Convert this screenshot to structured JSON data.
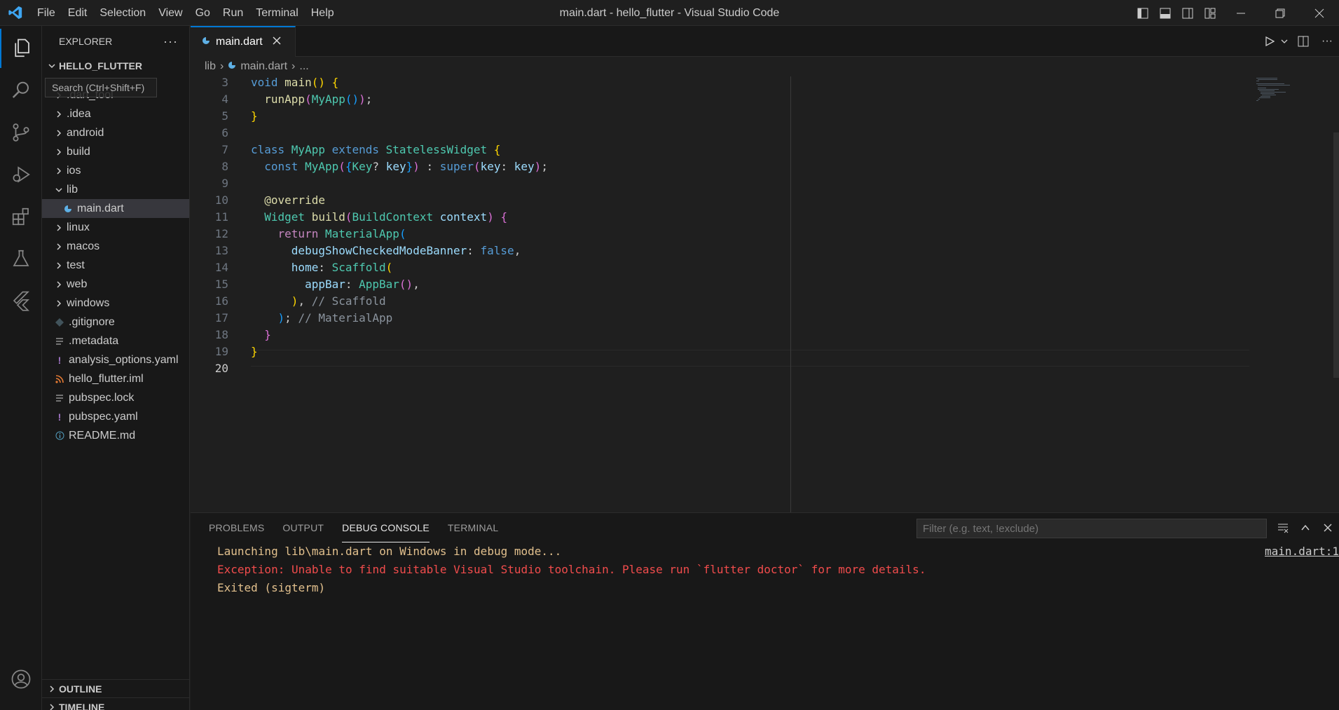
{
  "window": {
    "title": "main.dart - hello_flutter - Visual Studio Code"
  },
  "menu": [
    "File",
    "Edit",
    "Selection",
    "View",
    "Go",
    "Run",
    "Terminal",
    "Help"
  ],
  "tooltip": "Search (Ctrl+Shift+F)",
  "sidebar": {
    "title": "EXPLORER",
    "project": "HELLO_FLUTTER",
    "items": [
      {
        "label": ".dart_tool",
        "kind": "folder",
        "expanded": false
      },
      {
        "label": ".idea",
        "kind": "folder",
        "expanded": false
      },
      {
        "label": "android",
        "kind": "folder",
        "expanded": false
      },
      {
        "label": "build",
        "kind": "folder",
        "expanded": false
      },
      {
        "label": "ios",
        "kind": "folder",
        "expanded": false
      },
      {
        "label": "lib",
        "kind": "folder",
        "expanded": true
      },
      {
        "label": "main.dart",
        "kind": "dart",
        "selected": true
      },
      {
        "label": "linux",
        "kind": "folder",
        "expanded": false
      },
      {
        "label": "macos",
        "kind": "folder",
        "expanded": false
      },
      {
        "label": "test",
        "kind": "folder",
        "expanded": false
      },
      {
        "label": "web",
        "kind": "folder",
        "expanded": false
      },
      {
        "label": "windows",
        "kind": "folder",
        "expanded": false
      },
      {
        "label": ".gitignore",
        "kind": "git"
      },
      {
        "label": ".metadata",
        "kind": "lines"
      },
      {
        "label": "analysis_options.yaml",
        "kind": "yaml"
      },
      {
        "label": "hello_flutter.iml",
        "kind": "rss"
      },
      {
        "label": "pubspec.lock",
        "kind": "lines"
      },
      {
        "label": "pubspec.yaml",
        "kind": "yaml"
      },
      {
        "label": "README.md",
        "kind": "info"
      }
    ],
    "outline": "OUTLINE",
    "timeline": "TIMELINE"
  },
  "editor": {
    "tab": "main.dart",
    "breadcrumb": [
      "lib",
      "main.dart",
      "..."
    ],
    "lines": [
      {
        "n": "3",
        "tokens": [
          [
            "void ",
            "kw"
          ],
          [
            "main",
            "fn"
          ],
          [
            "() {",
            "b1"
          ]
        ]
      },
      {
        "n": "4",
        "tokens": [
          [
            "  runApp",
            "fn"
          ],
          [
            "(",
            "b2"
          ],
          [
            "MyApp",
            "ty"
          ],
          [
            "()",
            "b3"
          ],
          [
            ")",
            "b2"
          ],
          [
            ";",
            ""
          ]
        ]
      },
      {
        "n": "5",
        "tokens": [
          [
            "}",
            "b1"
          ]
        ]
      },
      {
        "n": "6",
        "tokens": []
      },
      {
        "n": "7",
        "tokens": [
          [
            "class ",
            "kw"
          ],
          [
            "MyApp ",
            "ty"
          ],
          [
            "extends ",
            "kw"
          ],
          [
            "StatelessWidget ",
            "ty"
          ],
          [
            "{",
            "b1"
          ]
        ]
      },
      {
        "n": "8",
        "tokens": [
          [
            "  const ",
            "kw"
          ],
          [
            "MyApp",
            "ty"
          ],
          [
            "(",
            "b2"
          ],
          [
            "{",
            "b3"
          ],
          [
            "Key",
            "ty"
          ],
          [
            "? ",
            ""
          ],
          [
            "key",
            "pr"
          ],
          [
            "}",
            "b3"
          ],
          [
            ")",
            "b2"
          ],
          [
            " : ",
            ""
          ],
          [
            "super",
            "kw"
          ],
          [
            "(",
            "b2"
          ],
          [
            "key",
            "pr"
          ],
          [
            ": ",
            ""
          ],
          [
            "key",
            "pr"
          ],
          [
            ")",
            "b2"
          ],
          [
            ";",
            ""
          ]
        ]
      },
      {
        "n": "9",
        "tokens": []
      },
      {
        "n": "10",
        "tokens": [
          [
            "  @override",
            "an"
          ]
        ]
      },
      {
        "n": "11",
        "tokens": [
          [
            "  Widget ",
            "ty"
          ],
          [
            "build",
            "fn"
          ],
          [
            "(",
            "b2"
          ],
          [
            "BuildContext ",
            "ty"
          ],
          [
            "context",
            "pr"
          ],
          [
            ") {",
            "b2"
          ]
        ]
      },
      {
        "n": "12",
        "tokens": [
          [
            "    return ",
            "ctl"
          ],
          [
            "MaterialApp",
            "ty"
          ],
          [
            "(",
            "b3"
          ]
        ]
      },
      {
        "n": "13",
        "tokens": [
          [
            "      debugShowCheckedModeBanner",
            "pr"
          ],
          [
            ": ",
            ""
          ],
          [
            "false",
            "kw"
          ],
          [
            ",",
            ""
          ]
        ]
      },
      {
        "n": "14",
        "tokens": [
          [
            "      home",
            "pr"
          ],
          [
            ": ",
            ""
          ],
          [
            "Scaffold",
            "ty"
          ],
          [
            "(",
            "b1"
          ]
        ]
      },
      {
        "n": "15",
        "tokens": [
          [
            "        appBar",
            "pr"
          ],
          [
            ": ",
            ""
          ],
          [
            "AppBar",
            "ty"
          ],
          [
            "()",
            "b2"
          ],
          [
            ",",
            ""
          ]
        ]
      },
      {
        "n": "16",
        "tokens": [
          [
            "      )",
            "b1"
          ],
          [
            ", ",
            ""
          ],
          [
            "// Scaffold",
            "cmg"
          ]
        ]
      },
      {
        "n": "17",
        "tokens": [
          [
            "    )",
            "b3"
          ],
          [
            "; ",
            ""
          ],
          [
            "// MaterialApp",
            "cmg"
          ]
        ]
      },
      {
        "n": "18",
        "tokens": [
          [
            "  }",
            "b2"
          ]
        ]
      },
      {
        "n": "19",
        "tokens": [
          [
            "}",
            "b1"
          ]
        ]
      },
      {
        "n": "20",
        "tokens": []
      }
    ]
  },
  "panel": {
    "tabs": [
      "PROBLEMS",
      "OUTPUT",
      "DEBUG CONSOLE",
      "TERMINAL"
    ],
    "active_tab": "DEBUG CONSOLE",
    "filter_placeholder": "Filter (e.g. text, !exclude)",
    "source_ref": "main.dart:1",
    "console": [
      {
        "text": "Launching lib\\main.dart on Windows in debug mode...",
        "color": "#e2c08d"
      },
      {
        "text": "Exception: Unable to find suitable Visual Studio toolchain. Please run `flutter doctor` for more details.",
        "color": "#f14c4c"
      },
      {
        "text": "Exited (sigterm)",
        "color": "#e2c08d"
      }
    ]
  },
  "colors": {
    "accent": "#0078d4",
    "bg": "#1f1f1f",
    "side": "#181818"
  }
}
